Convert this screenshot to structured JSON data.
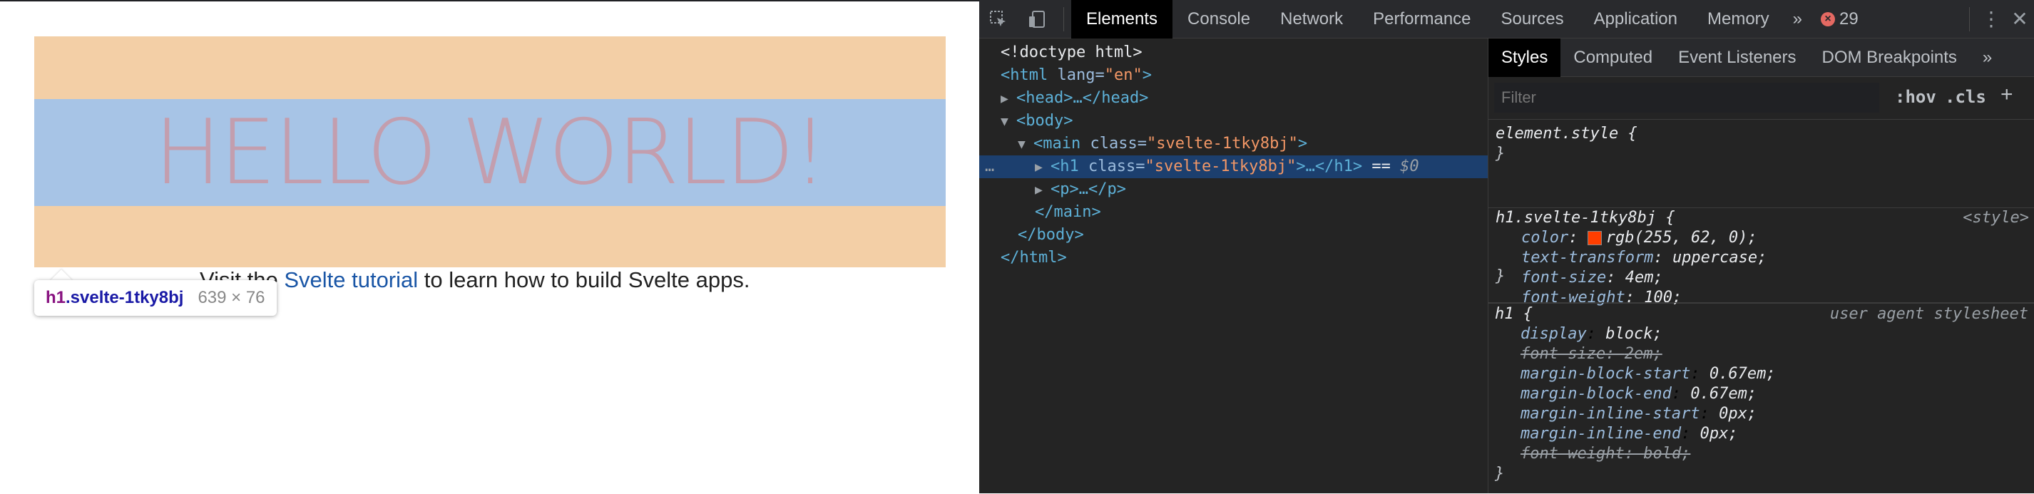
{
  "page": {
    "heading": "HELLO WORLD!",
    "paragraph_before": "Visit the ",
    "paragraph_link": "Svelte tutorial",
    "paragraph_after": " to learn how to build Svelte apps.",
    "tooltip": {
      "tag": "h1",
      "class": ".svelte-1tky8bj",
      "size": "639 × 76"
    }
  },
  "devtools": {
    "tabs": [
      "Elements",
      "Console",
      "Network",
      "Performance",
      "Sources",
      "Application",
      "Memory"
    ],
    "active_tab": "Elements",
    "more_tabs": "»",
    "error_count": "29",
    "dom": {
      "doctype": "<!doctype html>",
      "html_open_tag": "<html",
      "html_attr": " lang=",
      "html_val": "\"en\"",
      "html_close": ">",
      "head": "<head>…</head>",
      "body_open": "<body>",
      "main_tag": "<main",
      "main_attr": " class=",
      "main_val": "\"svelte-1tky8bj\"",
      "main_close": ">",
      "h1_tag": "<h1",
      "h1_attr": " class=",
      "h1_val": "\"svelte-1tky8bj\"",
      "h1_rest": ">…</h1>",
      "h1_eq": " == ",
      "h1_dollar": "$0",
      "ellipsis": "…",
      "p": "<p>…</p>",
      "main_end": "</main>",
      "body_end": "</body>",
      "html_end": "</html>"
    },
    "styles": {
      "tabs": [
        "Styles",
        "Computed",
        "Event Listeners",
        "DOM Breakpoints"
      ],
      "more_tabs": "»",
      "filter_placeholder": "Filter",
      "hov": ":hov",
      "cls": ".cls",
      "plus": "+",
      "element_style": "element.style {",
      "close_brace": "}",
      "rule1": {
        "selector": "h1.svelte-1tky8bj {",
        "source": "<style>",
        "props": [
          {
            "name": "color",
            "value": "rgb(255, 62, 0);",
            "swatch": "#ff3e00"
          },
          {
            "name": "text-transform",
            "value": "uppercase;"
          },
          {
            "name": "font-size",
            "value": "4em;"
          },
          {
            "name": "font-weight",
            "value": "100;"
          }
        ]
      },
      "rule2": {
        "selector": "h1 {",
        "source": "user agent stylesheet",
        "props": [
          {
            "name": "display",
            "value": "block;",
            "struck": false
          },
          {
            "name": "font-size",
            "value": "2em;",
            "struck": true
          },
          {
            "name": "margin-block-start",
            "value": "0.67em;",
            "struck": false
          },
          {
            "name": "margin-block-end",
            "value": "0.67em;",
            "struck": false
          },
          {
            "name": "margin-inline-start",
            "value": "0px;",
            "struck": false
          },
          {
            "name": "margin-inline-end",
            "value": "0px;",
            "struck": false
          },
          {
            "name": "font-weight",
            "value": "bold;",
            "struck": true
          }
        ]
      }
    }
  }
}
